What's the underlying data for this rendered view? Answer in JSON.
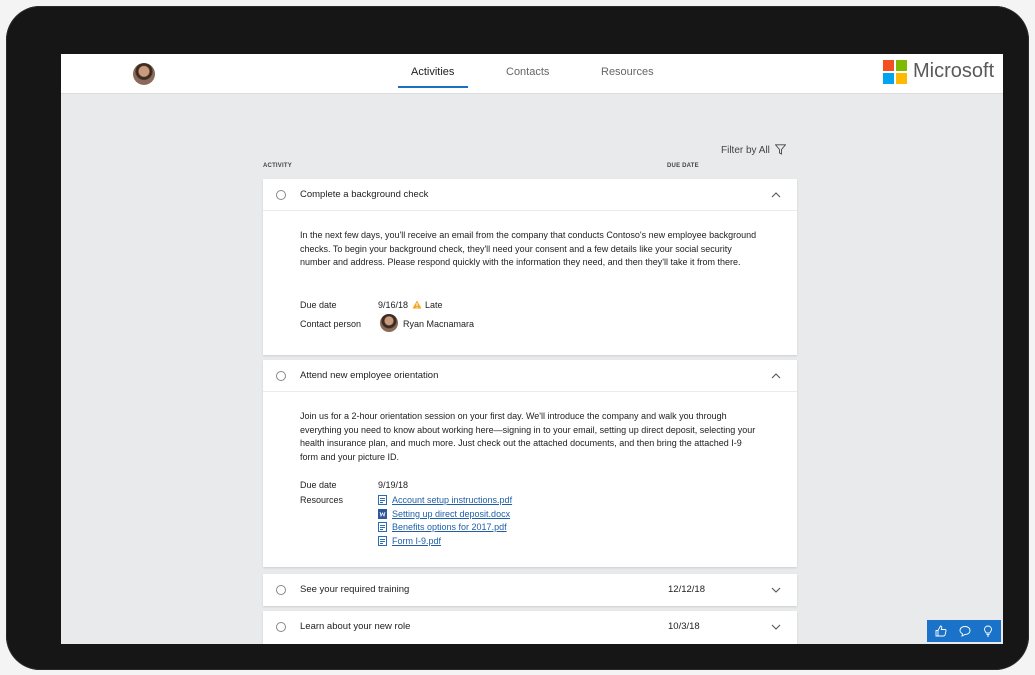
{
  "topbar": {
    "tabs": [
      {
        "label": "Activities",
        "active": true
      },
      {
        "label": "Contacts",
        "active": false
      },
      {
        "label": "Resources",
        "active": false
      }
    ],
    "brand": "Microsoft",
    "brand_colors": [
      "#f25022",
      "#7fba00",
      "#00a4ef",
      "#ffb900"
    ],
    "avatar_icon": "user-avatar"
  },
  "list": {
    "filter_label": "Filter by All",
    "filter_icon": "funnel-icon",
    "col_activity": "ACTIVITY",
    "col_due_date": "DUE DATE"
  },
  "activities": [
    {
      "title": "Complete a background check",
      "expanded": true,
      "description": "In the next few days, you'll receive an email from the company that conducts Contoso's new employee background checks. To begin your background check, they'll need your consent and a few details like your social security number and address. Please respond quickly with the information they need, and then they'll take it from there.",
      "due_label": "Due date",
      "due_date": "9/16/18",
      "status": "Late",
      "contact_label": "Contact person",
      "contact_name": "Ryan Macnamara"
    },
    {
      "title": "Attend new employee orientation",
      "expanded": true,
      "description": "Join us for a 2-hour orientation session on your first day. We'll introduce the company and walk you through everything you need to know about working here—signing in to your email, setting up direct deposit, selecting your health insurance plan, and much more. Just check out the attached documents, and then bring the attached I-9 form and your picture ID.",
      "due_label": "Due date",
      "due_date": "9/19/18",
      "resources_label": "Resources",
      "resources": [
        {
          "name": "Account setup instructions.pdf",
          "icon": "pdf-icon"
        },
        {
          "name": "Setting up direct deposit.docx",
          "icon": "word-doc-icon"
        },
        {
          "name": "Benefits options for 2017.pdf",
          "icon": "pdf-icon"
        },
        {
          "name": "Form I-9.pdf",
          "icon": "pdf-icon"
        }
      ]
    },
    {
      "title": "See your required training",
      "expanded": false,
      "due_date": "12/12/18"
    },
    {
      "title": "Learn about your new role",
      "expanded": false,
      "due_date": "10/3/18"
    }
  ],
  "feedback": {
    "icons": [
      "thumbs-up-icon",
      "comment-icon",
      "lightbulb-icon"
    ],
    "color": "#1a73c8"
  }
}
